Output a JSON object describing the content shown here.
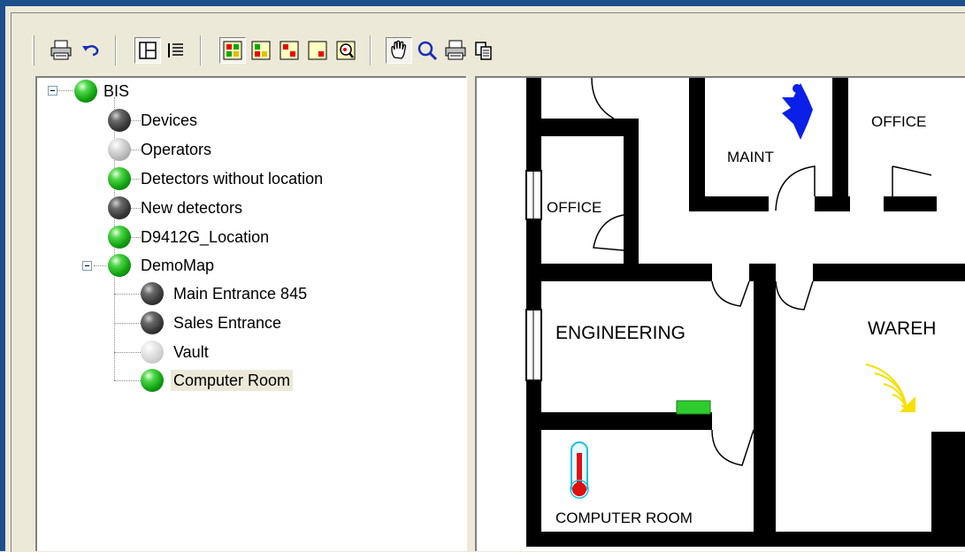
{
  "toolbar": {
    "buttons": [
      {
        "name": "print-icon"
      },
      {
        "name": "undo-icon"
      },
      {
        "name": "layout-tree-icon"
      },
      {
        "name": "list-view-icon"
      },
      {
        "name": "all-states-icon"
      },
      {
        "name": "alarm-fault-icon"
      },
      {
        "name": "alarm-icon"
      },
      {
        "name": "single-state-icon"
      },
      {
        "name": "zoom-map-icon"
      },
      {
        "name": "hand-pan-icon"
      },
      {
        "name": "magnifier-icon"
      },
      {
        "name": "print-map-icon"
      },
      {
        "name": "copy-icon"
      }
    ]
  },
  "tree": {
    "root": {
      "label": "BIS",
      "status": "green"
    },
    "children": [
      {
        "label": "Devices",
        "status": "dark"
      },
      {
        "label": "Operators",
        "status": "gray"
      },
      {
        "label": "Detectors without location",
        "status": "green"
      },
      {
        "label": "New detectors",
        "status": "dark"
      },
      {
        "label": "D9412G_Location",
        "status": "green"
      },
      {
        "label": "DemoMap",
        "status": "green"
      }
    ],
    "demomap_children": [
      {
        "label": "Main Entrance 845",
        "status": "dark"
      },
      {
        "label": "Sales Entrance",
        "status": "dark"
      },
      {
        "label": "Vault",
        "status": "lightgray"
      },
      {
        "label": "Computer Room",
        "status": "green",
        "selected": true
      }
    ]
  },
  "map": {
    "rooms": {
      "office_top": "OFFICE",
      "maint": "MAINT",
      "office_left": "OFFICE",
      "engineering": "ENGINEERING",
      "warehouse": "WAREH",
      "computer_room": "COMPUTER  ROOM"
    },
    "colors": {
      "wall": "#000000",
      "sensor": "#2ecc2e",
      "motion": "#ffff00",
      "person": "#0a1fe8",
      "thermo": "#e01010"
    }
  }
}
